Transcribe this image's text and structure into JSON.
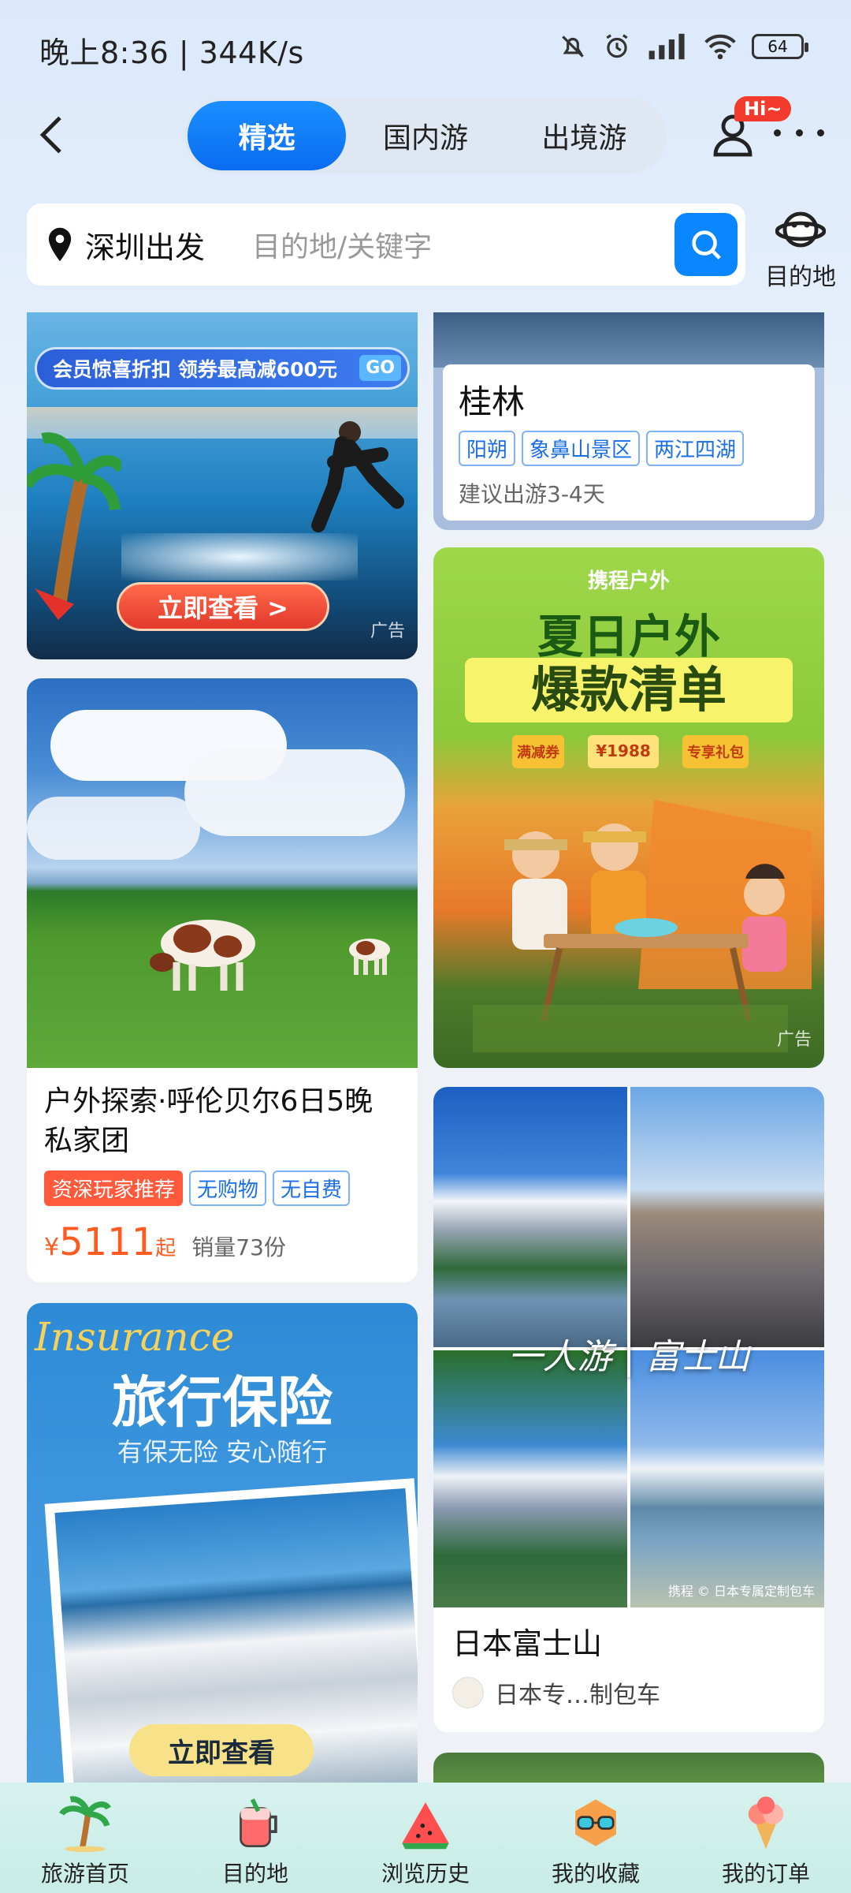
{
  "status_bar": {
    "time": "晚上8:36 | 344K/s",
    "battery": "64"
  },
  "header": {
    "tabs": [
      {
        "label": "精选",
        "active": true
      },
      {
        "label": "国内游",
        "active": false
      },
      {
        "label": "出境游",
        "active": false
      }
    ],
    "service_badge": "Hi~"
  },
  "search": {
    "departure": "深圳出发",
    "placeholder": "目的地/关键字",
    "destination_label": "目的地"
  },
  "feed": {
    "ad1": {
      "banner_text": "会员惊喜折扣 领券最高减600元",
      "go": "GO",
      "cta": "立即查看 >",
      "ad_label": "广告"
    },
    "guilin": {
      "title": "桂林",
      "tags": [
        "阳朔",
        "象鼻山景区",
        "两江四湖"
      ],
      "note": "建议出游3-4天"
    },
    "outdoor_ad": {
      "brand": "携程户外",
      "headline": "夏日户外",
      "subheadline": "爆款清单",
      "coupons": [
        "满减券",
        "¥1988",
        "专享礼包"
      ],
      "ad_label": "广告"
    },
    "hulunbuir": {
      "title": "户外探索·呼伦贝尔6日5晚私家团",
      "tags": [
        {
          "label": "资深玩家推荐",
          "hot": true
        },
        {
          "label": "无购物",
          "hot": false
        },
        {
          "label": "无自费",
          "hot": false
        }
      ],
      "price_symbol": "¥",
      "price": "5111",
      "price_suffix": "起",
      "sales": "销量73份"
    },
    "fuji": {
      "overlay": "一人游 | 富士山",
      "watermark": "携程 © 日本专属定制包车",
      "title": "日本富士山",
      "author": "日本专…制包车"
    },
    "insurance_ad": {
      "script": "Insurance",
      "headline": "旅行保险",
      "subheadline": "有保无险 安心随行",
      "cta": "立即查看"
    }
  },
  "bottom_nav": [
    {
      "label": "旅游首页",
      "icon": "palm-tree-icon"
    },
    {
      "label": "目的地",
      "icon": "drink-jar-icon"
    },
    {
      "label": "浏览历史",
      "icon": "watermelon-icon"
    },
    {
      "label": "我的收藏",
      "icon": "sunglasses-icon"
    },
    {
      "label": "我的订单",
      "icon": "ice-cream-icon"
    }
  ],
  "colors": {
    "accent": "#0a86ff",
    "price": "#ff5a1f",
    "hot_tag": "#ff5a3c"
  }
}
